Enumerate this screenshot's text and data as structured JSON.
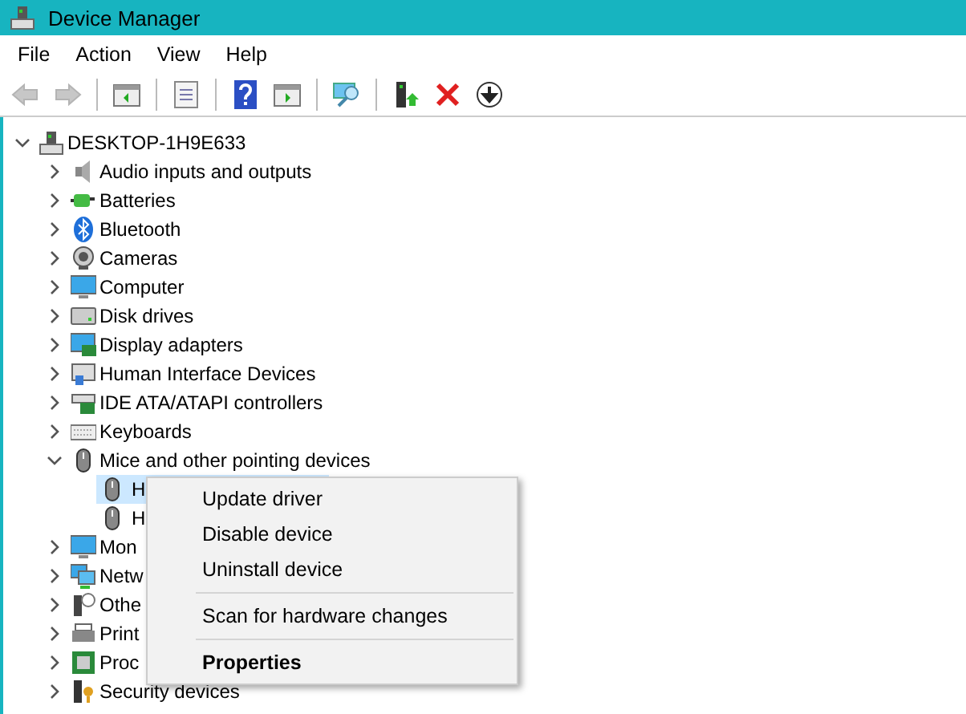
{
  "window": {
    "title": "Device Manager"
  },
  "menu_bar": [
    "File",
    "Action",
    "View",
    "Help"
  ],
  "toolbar": [
    {
      "kind": "back",
      "disabled": true
    },
    {
      "kind": "forward",
      "disabled": true
    },
    {
      "kind": "separator"
    },
    {
      "kind": "console-tree",
      "disabled": false
    },
    {
      "kind": "separator"
    },
    {
      "kind": "properties",
      "disabled": false
    },
    {
      "kind": "separator"
    },
    {
      "kind": "help",
      "disabled": false
    },
    {
      "kind": "action-pane",
      "disabled": false
    },
    {
      "kind": "separator"
    },
    {
      "kind": "scan",
      "disabled": false
    },
    {
      "kind": "separator"
    },
    {
      "kind": "update",
      "disabled": false
    },
    {
      "kind": "uninstall",
      "disabled": false
    },
    {
      "kind": "disable",
      "disabled": false
    }
  ],
  "tree": {
    "label": "DESKTOP-1H9E633",
    "kind": "computer",
    "expanded": true,
    "children": [
      {
        "label": "Audio inputs and outputs",
        "kind": "speaker",
        "expanded": false
      },
      {
        "label": "Batteries",
        "kind": "battery",
        "expanded": false
      },
      {
        "label": "Bluetooth",
        "kind": "bluetooth",
        "expanded": false
      },
      {
        "label": "Cameras",
        "kind": "camera",
        "expanded": false
      },
      {
        "label": "Computer",
        "kind": "monitor",
        "expanded": false
      },
      {
        "label": "Disk drives",
        "kind": "disk",
        "expanded": false
      },
      {
        "label": "Display adapters",
        "kind": "display",
        "expanded": false
      },
      {
        "label": "Human Interface Devices",
        "kind": "hid",
        "expanded": false
      },
      {
        "label": "IDE ATA/ATAPI controllers",
        "kind": "card",
        "expanded": false
      },
      {
        "label": "Keyboards",
        "kind": "keyboard",
        "expanded": false
      },
      {
        "label": "Mice and other pointing devices",
        "kind": "mouse",
        "expanded": true,
        "children": [
          {
            "label": "H",
            "kind": "mouse",
            "selected": true
          },
          {
            "label": "H",
            "kind": "mouse",
            "selected": false
          }
        ]
      },
      {
        "label": "Mon",
        "kind": "monitor",
        "expanded": false
      },
      {
        "label": "Netw",
        "kind": "network",
        "expanded": false
      },
      {
        "label": "Othe",
        "kind": "other",
        "expanded": false
      },
      {
        "label": "Print",
        "kind": "printer",
        "expanded": false
      },
      {
        "label": "Proc",
        "kind": "chip",
        "expanded": false
      },
      {
        "label": "Security devices",
        "kind": "security",
        "expanded": false
      }
    ]
  },
  "context_menu": [
    {
      "kind": "item",
      "label": "Update driver",
      "default": false
    },
    {
      "kind": "item",
      "label": "Disable device",
      "default": false
    },
    {
      "kind": "item",
      "label": "Uninstall device",
      "default": false
    },
    {
      "kind": "separator"
    },
    {
      "kind": "item",
      "label": "Scan for hardware changes",
      "default": false
    },
    {
      "kind": "separator"
    },
    {
      "kind": "item",
      "label": "Properties",
      "default": true
    }
  ]
}
